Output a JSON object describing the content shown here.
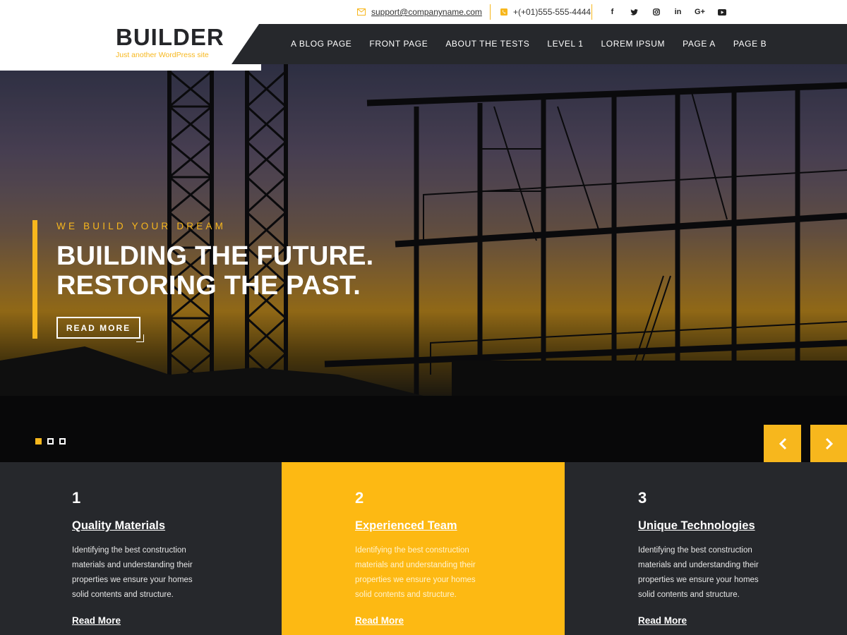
{
  "contact": {
    "email": "support@companyname.com",
    "phone": "+(+01)555-555-4444"
  },
  "social_icons": [
    "facebook-icon",
    "twitter-icon",
    "instagram-icon",
    "linkedin-icon",
    "google-plus-icon",
    "youtube-icon"
  ],
  "site": {
    "name": "BUILDER",
    "tagline": "Just another WordPress site"
  },
  "nav": {
    "items": [
      "A BLOG PAGE",
      "FRONT PAGE",
      "ABOUT THE TESTS",
      "LEVEL 1",
      "LOREM IPSUM",
      "PAGE A",
      "PAGE B"
    ]
  },
  "hero": {
    "subtitle": "WE BUILD YOUR DREAM",
    "title_line1": "BUILDING THE FUTURE.",
    "title_line2": "RESTORING THE PAST.",
    "button": "READ MORE",
    "slides_total": 3,
    "slide_active": 1
  },
  "features": [
    {
      "number": "1",
      "title": "Quality Materials",
      "description": "Identifying the best construction materials and understanding their properties we ensure your homes solid contents and structure.",
      "link": "Read More"
    },
    {
      "number": "2",
      "title": "Experienced Team",
      "description": "Identifying the best construction materials and understanding their properties we ensure your homes solid contents and structure.",
      "link": "Read More"
    },
    {
      "number": "3",
      "title": "Unique Technologies",
      "description": "Identifying the best construction materials and understanding their properties we ensure your homes solid contents and structure.",
      "link": "Read More"
    }
  ],
  "colors": {
    "accent": "#fdb913",
    "dark": "#26282c",
    "text_light": "#ffffff"
  }
}
